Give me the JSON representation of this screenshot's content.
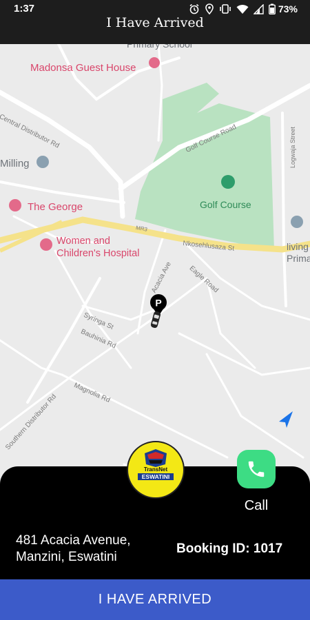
{
  "status_bar": {
    "time": "1:37",
    "battery": "73%",
    "icons": [
      "alarm-icon",
      "location-icon",
      "vibrate-icon",
      "wifi-icon",
      "signal-icon",
      "battery-icon"
    ]
  },
  "header": {
    "title": "I Have Arrived"
  },
  "map": {
    "pois": {
      "primary_school_top": "Primary School",
      "madonsa": "Madonsa Guest House",
      "milling": "Milling",
      "the_george": "The George",
      "hospital_line1": "Women and",
      "hospital_line2": "Children's Hospital",
      "golf_course": "Golf Course",
      "living_line1": "living",
      "living_line2": "Prima"
    },
    "streets": {
      "central_distributor": "Central Distributor Rd",
      "golf_course_road": "Golf Course Road",
      "mr3": "MR3",
      "nkosehlusaza": "Nkosehlusaza St",
      "logwaja": "Logwaja Street",
      "acacia": "Acacia Ave",
      "eagle": "Eagle Road",
      "syringa": "Syringa St",
      "bauhinia": "Bauhinia Rd",
      "magnolia": "Magnolia Rd",
      "southern_distributor": "Southern Distributor Rd"
    },
    "parking_marker": "P",
    "colors": {
      "background": "#ebebeb",
      "roads": "#ffffff",
      "highway": "#f5e28a",
      "park": "#b9e2c1"
    }
  },
  "company_logo": {
    "brand": "TransNet",
    "country": "ESWATINI"
  },
  "call": {
    "label": "Call"
  },
  "trip": {
    "address_line1": "481 Acacia Avenue,",
    "address_line2": "Manzini, Eswatini",
    "booking": "Booking ID: 1017"
  },
  "action": {
    "arrived_label": "I HAVE ARRIVED"
  },
  "colors": {
    "accent": "#3c5bc9",
    "call": "#3ddc84",
    "logo": "#f3e815"
  }
}
